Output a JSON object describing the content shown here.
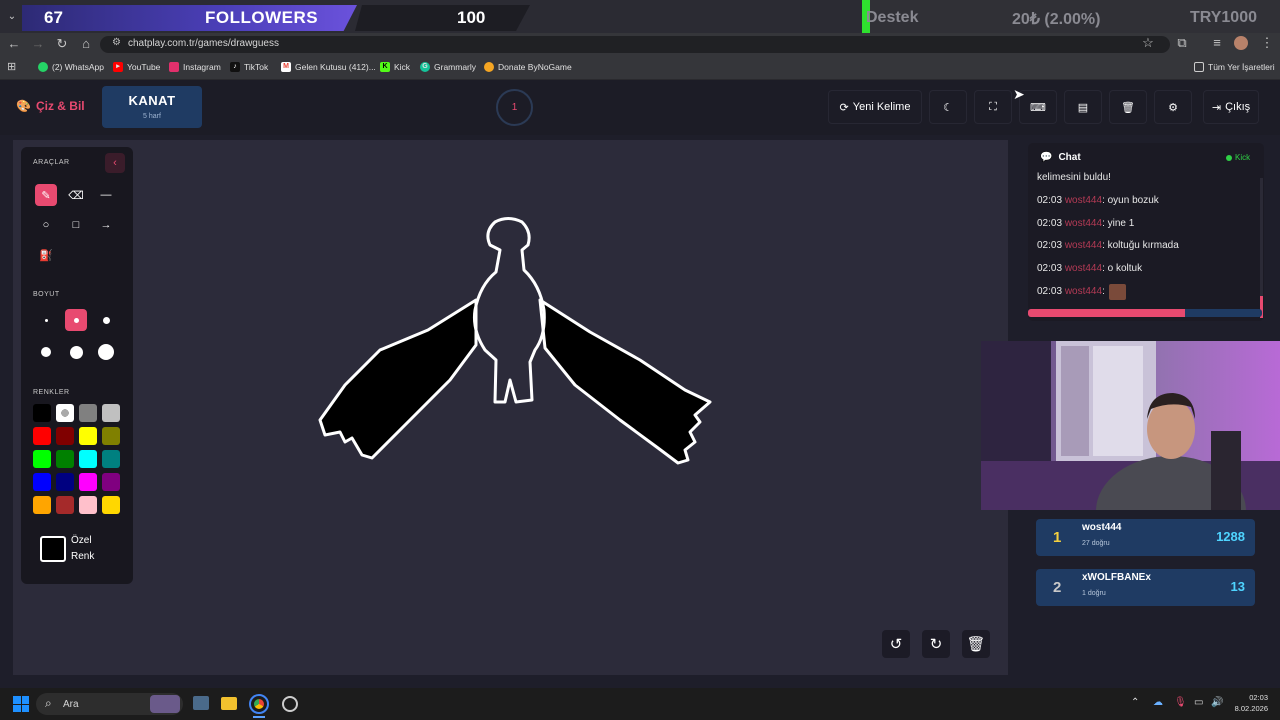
{
  "overlay": {
    "followers_count": "67",
    "followers_label": "FOLLOWERS",
    "followers_goal": "100",
    "support_label": "Destek",
    "support_amount": "20₺ (2.00%)",
    "support_goal": "TRY1000"
  },
  "browser": {
    "url": "chatplay.com.tr/games/drawguess",
    "bookmarks": [
      {
        "label": "(2) WhatsApp",
        "icon": "whatsapp-icon",
        "color": "#25d366"
      },
      {
        "label": "YouTube",
        "icon": "youtube-icon",
        "color": "#ff0000"
      },
      {
        "label": "Instagram",
        "icon": "instagram-icon",
        "color": "#e1306c"
      },
      {
        "label": "TikTok",
        "icon": "tiktok-icon",
        "color": "#000000"
      },
      {
        "label": "Gelen Kutusu (412)...",
        "icon": "gmail-icon",
        "color": "#ea4335"
      },
      {
        "label": "Kick",
        "icon": "kick-icon",
        "color": "#53fc18"
      },
      {
        "label": "Grammarly",
        "icon": "grammarly-icon",
        "color": "#15c39a"
      },
      {
        "label": "Donate ByNoGame",
        "icon": "donate-icon",
        "color": "#f5a623"
      }
    ],
    "bookmarks_folder": "Tüm Yer İşaretleri"
  },
  "app": {
    "logo": "Çiz & Bil",
    "word": "KANAT",
    "word_hint": "5 harf",
    "timer": "1",
    "new_word": "Yeni Kelime",
    "logout": "Çıkış"
  },
  "tools": {
    "tools_header": "ARAÇLAR",
    "size_header": "BOYUT",
    "colors_header": "RENKLER",
    "custom_color_line1": "Özel",
    "custom_color_line2": "Renk",
    "colors": [
      "#000000",
      "#ffffff",
      "#808080",
      "#c0c0c0",
      "#ff0000",
      "#800000",
      "#ffff00",
      "#808000",
      "#00ff00",
      "#008000",
      "#00ffff",
      "#008080",
      "#0000ff",
      "#000080",
      "#ff00ff",
      "#800080",
      "#ffa500",
      "#a52a2a",
      "#ffc0cb",
      "#ffd700"
    ]
  },
  "chat": {
    "title": "Chat",
    "platform": "Kick",
    "partial_top": "kelimesini buldu!",
    "messages": [
      {
        "time": "02:03",
        "user": "wost444",
        "text": ": oyun bozuk"
      },
      {
        "time": "02:03",
        "user": "wost444",
        "text": ": yine 1"
      },
      {
        "time": "02:03",
        "user": "wost444",
        "text": ": koltuğu kırmada"
      },
      {
        "time": "02:03",
        "user": "wost444",
        "text": ": o koltuk"
      },
      {
        "time": "02:03",
        "user": "wost444",
        "text": ":"
      }
    ],
    "progress": 0.67
  },
  "scores": [
    {
      "rank": "1",
      "name": "wost444",
      "sub": "27 doğru",
      "points": "1288"
    },
    {
      "rank": "2",
      "name": "xWOLFBANEx",
      "sub": "1 doğru",
      "points": "13"
    }
  ],
  "taskbar": {
    "search": "Ara",
    "time": "02:03",
    "date": "8.02.2026"
  },
  "colors": {
    "accent": "#e84a70",
    "panel_blue": "#1f3b63"
  }
}
